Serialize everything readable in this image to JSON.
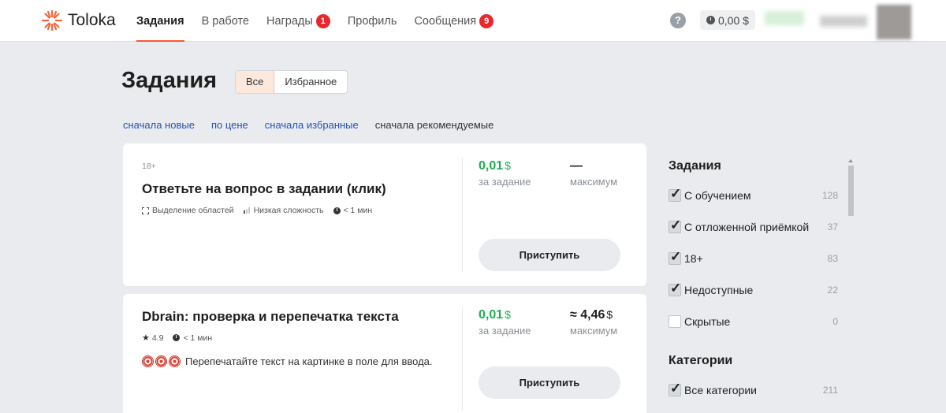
{
  "app": {
    "logo_text": "Toloka"
  },
  "nav": {
    "tasks": "Задания",
    "in_progress": "В работе",
    "rewards": "Награды",
    "rewards_badge": "1",
    "profile": "Профиль",
    "messages": "Сообщения",
    "messages_badge": "9"
  },
  "header": {
    "help": "?",
    "balance": "0,00 $"
  },
  "page": {
    "title": "Задания",
    "segments": [
      "Все",
      "Избранное"
    ],
    "sort": [
      "сначала новые",
      "по цене",
      "сначала избранные",
      "сначала рекомендуемые"
    ]
  },
  "tasks": [
    {
      "age": "18+",
      "title": "Ответьте на вопрос в задании (клик)",
      "meta": [
        "Выделение областей",
        "Низкая сложность",
        "< 1 мин"
      ],
      "price": "0,01",
      "currency": "$",
      "price_caption": "за задание",
      "max_value": "—",
      "max_caption": "максимум",
      "button": "Приступить"
    },
    {
      "title": "Dbrain: проверка и перепечатка текста",
      "rating": "4.9",
      "time": "< 1 мин",
      "description": "Перепечатайте текст на картинке в поле для ввода.",
      "price": "0,01",
      "currency": "$",
      "price_caption": "за задание",
      "max_value": "≈ 4,46",
      "max_currency": "$",
      "max_caption": "максимум",
      "button": "Приступить"
    }
  ],
  "filters": {
    "tasks_heading": "Задания",
    "tasks_items": [
      {
        "label": "С обучением",
        "count": "128",
        "checked": true
      },
      {
        "label": "С отложенной приёмкой",
        "count": "37",
        "checked": true
      },
      {
        "label": "18+",
        "count": "83",
        "checked": true
      },
      {
        "label": "Недоступные",
        "count": "22",
        "checked": true
      },
      {
        "label": "Скрытые",
        "count": "0",
        "checked": false
      }
    ],
    "categories_heading": "Категории",
    "categories_items": [
      {
        "label": "Все категории",
        "count": "211",
        "checked": true
      }
    ]
  },
  "colors": {
    "accent": "#f55a36",
    "price_green": "#1fae53",
    "badge_red": "#e8262c",
    "link_blue": "#2551b4"
  }
}
